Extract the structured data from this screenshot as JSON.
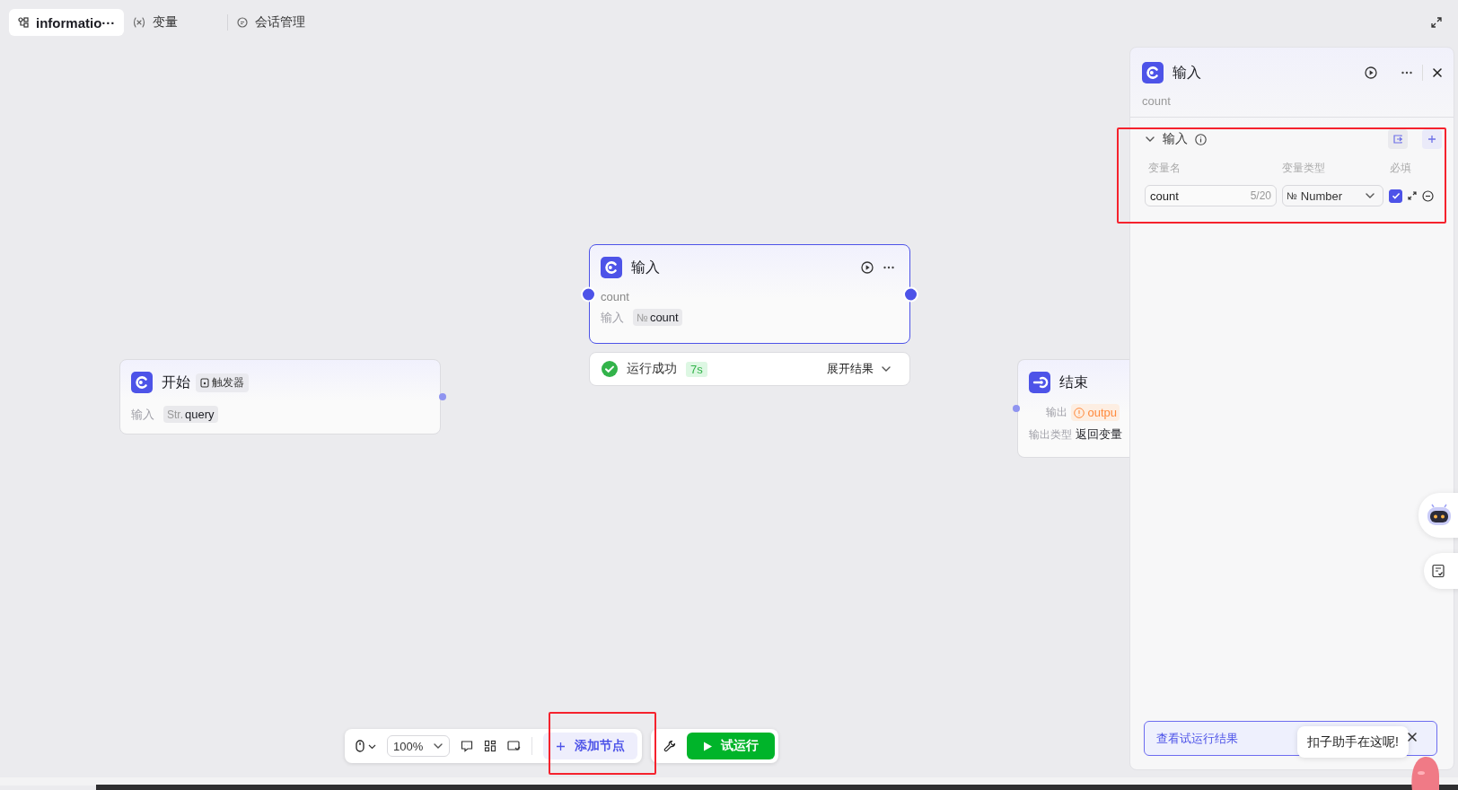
{
  "tabs": [
    {
      "label": "informatio···",
      "selected": true
    },
    {
      "label": "变量",
      "selected": false
    },
    {
      "label": "会话管理",
      "selected": false
    }
  ],
  "nodes": [
    {
      "kind": "start",
      "title": "开始",
      "selected": false,
      "badge": "触发器",
      "rows": [
        {
          "label": "输入",
          "type": "Str.",
          "value": "query"
        }
      ]
    },
    {
      "kind": "input",
      "title": "输入",
      "selected": true,
      "description": "count",
      "rows": [
        {
          "label": "输入",
          "type": "№",
          "value": "count"
        }
      ],
      "run": {
        "status": "运行成功",
        "time": "7s",
        "toggle": "展开结果"
      }
    },
    {
      "kind": "end",
      "title": "结束",
      "selected": false,
      "rows": [
        {
          "label": "输出",
          "value": "outpu",
          "warning": true
        },
        {
          "label": "输出类型",
          "value": "返回变量",
          "warning": false
        }
      ]
    }
  ],
  "panel": {
    "title": "输入",
    "description": "count",
    "section": {
      "title": "输入",
      "expanded": true,
      "highlighted": true,
      "columns": [
        "变量名",
        "变量类型",
        "必填"
      ],
      "params": [
        {
          "name": "count",
          "counter": "5/20",
          "type_icon": "№",
          "type": "Number",
          "required": true
        }
      ]
    },
    "result_button": "查看试运行结果"
  },
  "toolbar": {
    "zoom": "100%",
    "add_node": {
      "label": "添加节点",
      "highlighted": true
    },
    "test_run": "试运行"
  },
  "assistant": {
    "bubble": "扣子助手在这呢!"
  }
}
